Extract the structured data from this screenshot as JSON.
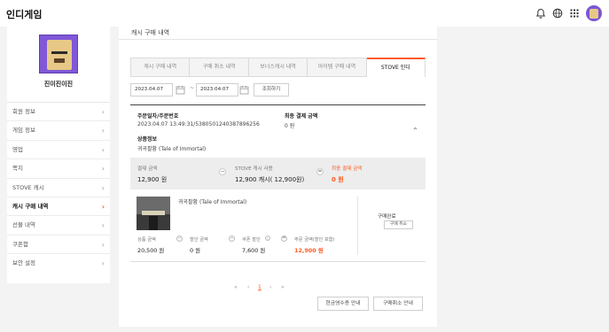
{
  "header": {
    "brand": "인디게임",
    "icons": [
      "bell-icon",
      "globe-icon",
      "apps-grid-icon",
      "user-avatar"
    ]
  },
  "sidebar": {
    "profile_name": "진이진이진",
    "items": [
      {
        "label": "회원 정보"
      },
      {
        "label": "게임 정보"
      },
      {
        "label": "영업"
      },
      {
        "label": "쪽지"
      },
      {
        "label": "STOVE 캐시"
      },
      {
        "label": "캐시 구매 내역",
        "active": true
      },
      {
        "label": "선물 내역"
      },
      {
        "label": "쿠폰함"
      },
      {
        "label": "보안 설정"
      }
    ]
  },
  "main": {
    "section_title": "캐시 구매 내역",
    "tabs": [
      {
        "label": "캐시 구매 내역"
      },
      {
        "label": "구매 취소 내역"
      },
      {
        "label": "보너스캐시 내역"
      },
      {
        "label": "아이템 구매 내역"
      },
      {
        "label": "STOVE 인디",
        "active": true
      }
    ],
    "filter": {
      "start_date": "2023.04.07",
      "end_date": "2023.04.07",
      "separator": "~",
      "query_label": "조회하기"
    },
    "order": {
      "date_label": "주문일자/주문번호",
      "date_value": "2023.04.07 13:49:31/5380501240387896256",
      "final_label": "최종 결제 금액",
      "final_value": "0 원",
      "product_info_label": "상품정보",
      "product_info_value": "귀곡팔황 (Tale of Immortal)",
      "summary": {
        "payment_label": "결제 금액",
        "payment_value": "12,900 원",
        "cash_label": "STOVE 캐시 사용",
        "cash_value": "12,900 캐시( 12,900원)",
        "final_label": "최종 결제 금액",
        "final_value": "0 원",
        "minus": "−",
        "equals": "="
      },
      "product": {
        "name": "귀곡팔황 (Tale of Immortal)",
        "price_label": "상품 금액",
        "price_value": "20,500 원",
        "discount_label": "할인 금액",
        "discount_value": "0 원",
        "coupon_label": "쿠폰 할인",
        "coupon_value": "7,600 원",
        "order_label": "주문 금액(할인 포함)",
        "order_value": "12,900 원",
        "status_label": "구매완료",
        "cancel_label": "구매 취소",
        "minus": "−",
        "equals": "="
      }
    },
    "pagination": {
      "first": "«",
      "prev": "‹",
      "current": "1",
      "next": "›",
      "last": "»"
    },
    "footer": {
      "receipt_label": "현금영수증 안내",
      "cancel_guide_label": "구매취소 안내"
    }
  },
  "colors": {
    "accent": "#ff5a1f",
    "avatar_purple": "#8058d8",
    "page_bg": "#f3f3f3"
  }
}
